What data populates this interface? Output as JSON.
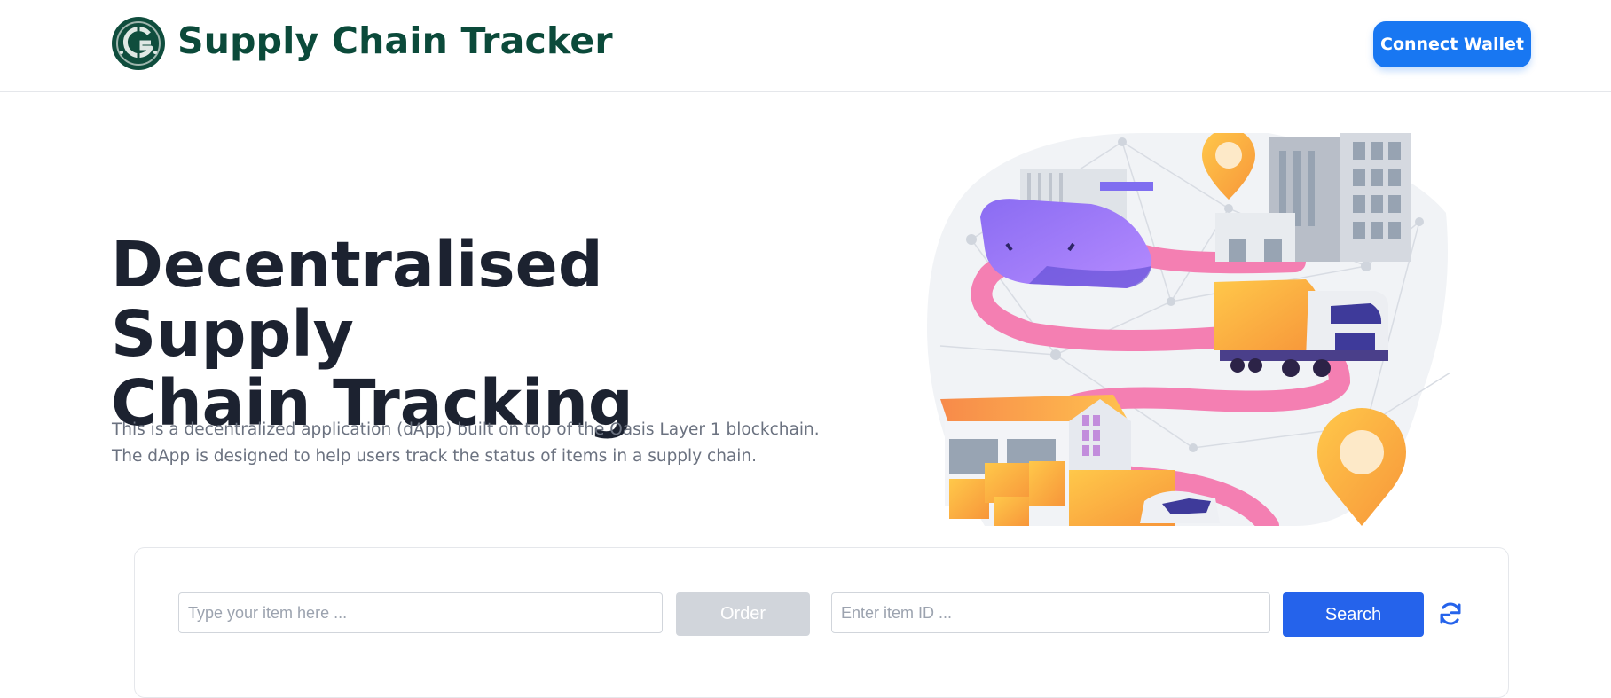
{
  "header": {
    "logo_icon": "supply-chain-logo-icon",
    "title": "Supply Chain Tracker",
    "connect_wallet_label": "Connect Wallet"
  },
  "hero": {
    "title_line1": "Decentralised Supply",
    "title_line2": "Chain Tracking",
    "description_line1": "This is a decentralized application (dApp) built on top of the Oasis Layer 1 blockchain.",
    "description_line2": "The dApp is designed to help users track the status of items in a supply chain.",
    "illustration_icon": "supply-chain-illustration"
  },
  "actions": {
    "item_placeholder": "Type your item here ...",
    "order_label": "Order",
    "id_placeholder": "Enter item ID ...",
    "search_label": "Search",
    "refresh_icon": "refresh-icon"
  },
  "colors": {
    "brand": "#0b4a3a",
    "primary": "#1877f2",
    "search": "#2563eb",
    "disabled": "#d1d5db"
  }
}
